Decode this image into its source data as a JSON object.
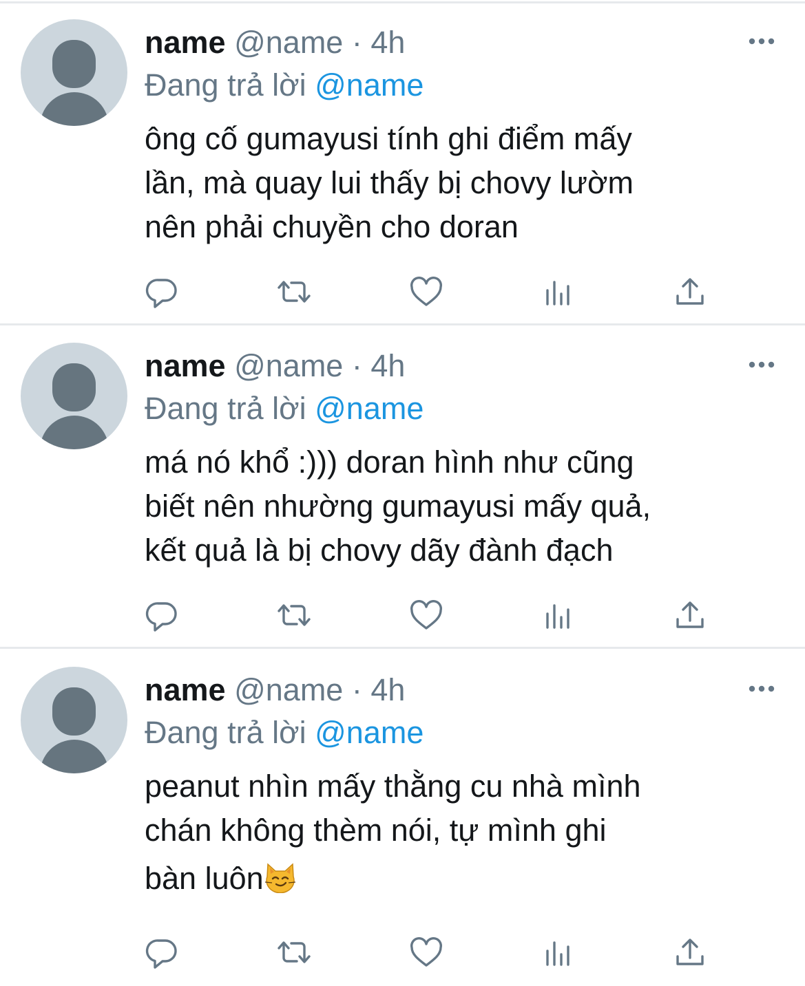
{
  "tweets": [
    {
      "name": "name",
      "handle": "@name",
      "dot": "·",
      "time": "4h",
      "reply_prefix": "Đang trả lời",
      "reply_to": "@name",
      "text_lines": [
        "ông cố gumayusi tính ghi điểm mấy",
        "lần, mà quay lui thấy bị chovy lườm",
        "nên phải chuyền cho doran"
      ]
    },
    {
      "name": "name",
      "handle": "@name",
      "dot": "·",
      "time": "4h",
      "reply_prefix": "Đang trả lời",
      "reply_to": "@name",
      "text_lines": [
        "má nó khổ :))) doran hình như cũng",
        "biết nên nhường gumayusi mấy quả,",
        "kết quả là bị chovy dãy đành đạch"
      ]
    },
    {
      "name": "name",
      "handle": "@name",
      "dot": "·",
      "time": "4h",
      "reply_prefix": "Đang trả lời",
      "reply_to": "@name",
      "text_lines": [
        "peanut nhìn mấy thằng cu nhà mình",
        "chán không thèm nói, tự mình ghi",
        "bàn luôn"
      ],
      "trailing_emoji": "smirking-cat-emoji"
    }
  ],
  "actions": [
    "reply-icon",
    "retweet-icon",
    "like-icon",
    "analytics-icon",
    "share-icon"
  ],
  "colors": {
    "text": "#14171a",
    "secondary": "#657786",
    "link": "#1b95e0",
    "avatar_bg": "#ccd6dd",
    "avatar_fg": "#66757f",
    "divider": "#e6e9ec"
  }
}
